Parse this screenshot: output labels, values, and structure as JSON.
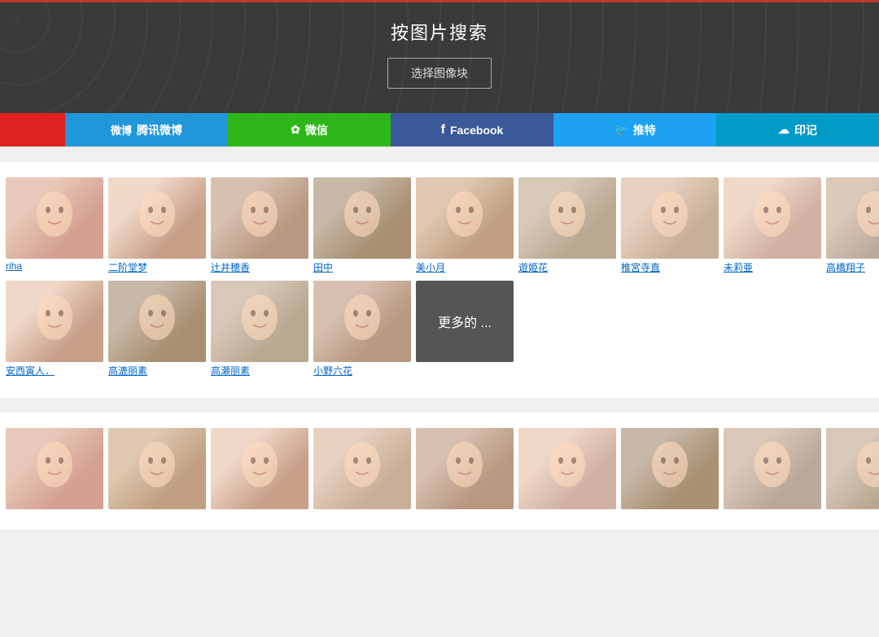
{
  "header": {
    "title": "按图片搜索",
    "select_button": "选择图像块",
    "border_color": "#c0392b"
  },
  "share_bar": [
    {
      "id": "weibo-red",
      "label": "",
      "class": "weibo-red"
    },
    {
      "id": "weibo-blue",
      "label": "腾讯微博",
      "icon": "微博",
      "class": "weibo-blue"
    },
    {
      "id": "wechat",
      "label": "微信",
      "icon": "微信",
      "class": "wechat"
    },
    {
      "id": "facebook",
      "label": "Facebook",
      "icon": "f",
      "class": "facebook"
    },
    {
      "id": "twitter",
      "label": "推特",
      "icon": "t",
      "class": "twitter"
    },
    {
      "id": "hatena",
      "label": "印记",
      "icon": "印",
      "class": "hatena"
    }
  ],
  "gallery1": {
    "items": [
      {
        "label": "riha",
        "face_class": "face1"
      },
      {
        "label": "二阶堂梦",
        "face_class": "face2"
      },
      {
        "label": "辻井穂香",
        "face_class": "face3"
      },
      {
        "label": "田中",
        "face_class": "face4"
      },
      {
        "label": "美小月",
        "face_class": "face5"
      },
      {
        "label": "遊姫花",
        "face_class": "face6"
      },
      {
        "label": "椎宮寺直",
        "face_class": "face7"
      },
      {
        "label": "未莉亜",
        "face_class": "face8"
      },
      {
        "label": "高橋翔子",
        "face_class": "face9"
      }
    ]
  },
  "gallery2": {
    "items": [
      {
        "label": "安西寅人．",
        "face_class": "face2"
      },
      {
        "label": "高漉丽素",
        "face_class": "face4"
      },
      {
        "label": "高瀬丽素",
        "face_class": "face6"
      },
      {
        "label": "小野六花",
        "face_class": "face3"
      },
      {
        "label": "更多的 ...",
        "is_more": true
      }
    ]
  },
  "gallery3": {
    "items": [
      {
        "label": "",
        "face_class": "face1"
      },
      {
        "label": "",
        "face_class": "face5"
      },
      {
        "label": "",
        "face_class": "face2"
      },
      {
        "label": "",
        "face_class": "face7"
      },
      {
        "label": "",
        "face_class": "face3"
      },
      {
        "label": "",
        "face_class": "face8"
      },
      {
        "label": "",
        "face_class": "face4"
      },
      {
        "label": "",
        "face_class": "face9"
      },
      {
        "label": "",
        "face_class": "face6"
      }
    ]
  }
}
